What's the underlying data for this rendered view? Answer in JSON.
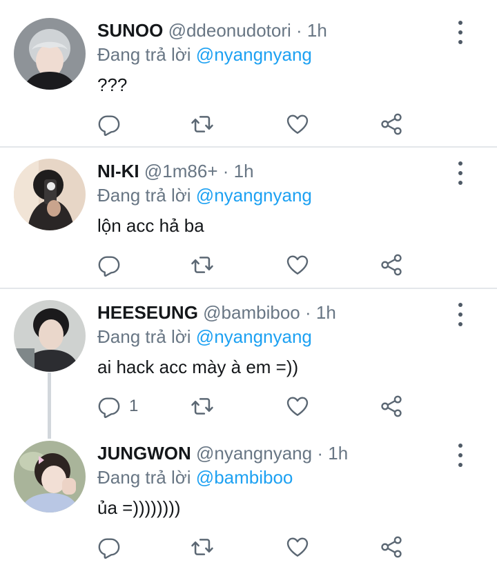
{
  "tweets": [
    {
      "name": "SUNOO",
      "handle": "@ddeonudotori",
      "dot": "·",
      "time": "1h",
      "reply_prefix": "Đang trả lời",
      "reply_to": "@nyangnyang",
      "text": "???",
      "reply_count": ""
    },
    {
      "name": "NI-KI",
      "handle": "@1m86+",
      "dot": "·",
      "time": "1h",
      "reply_prefix": "Đang trả lời",
      "reply_to": "@nyangnyang",
      "text": "lộn acc hả ba",
      "reply_count": ""
    },
    {
      "name": "HEESEUNG",
      "handle": "@bambiboo",
      "dot": "·",
      "time": "1h",
      "reply_prefix": "Đang trả lời",
      "reply_to": "@nyangnyang",
      "text": "ai hack acc mày à em =))",
      "reply_count": "1"
    },
    {
      "name": "JUNGWON",
      "handle": "@nyangnyang",
      "dot": "·",
      "time": "1h",
      "reply_prefix": "Đang trả lời",
      "reply_to": "@bambiboo",
      "text": "ủa =))))))))",
      "reply_count": ""
    }
  ],
  "icons": {
    "reply": "reply-icon",
    "retweet": "retweet-icon",
    "like": "heart-icon",
    "share": "share-icon",
    "more": "more-vertical-icon"
  },
  "colors": {
    "mention": "#1da1f2",
    "secondary_text": "#687684",
    "icon": "#5b6773",
    "divider": "#e3e6ea"
  }
}
